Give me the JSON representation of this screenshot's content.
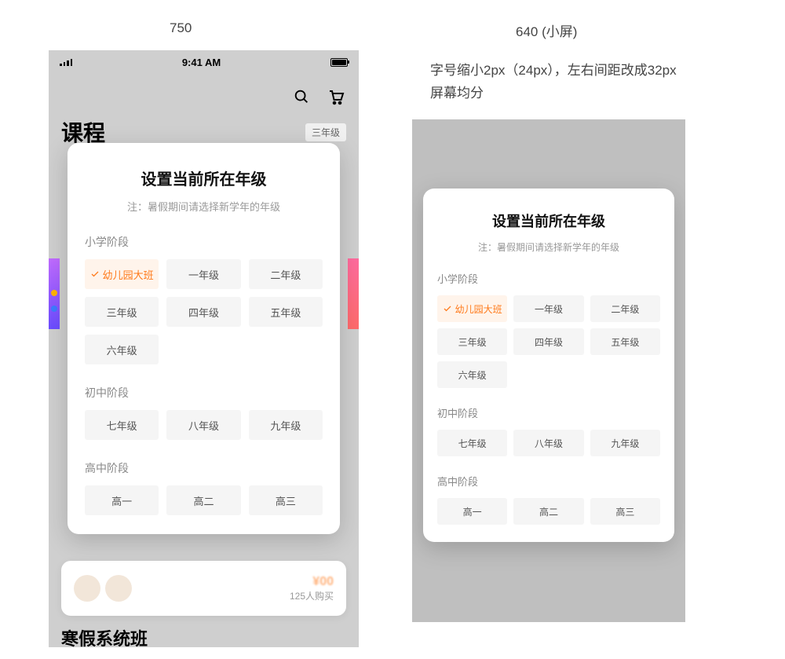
{
  "labels": {
    "col_left": "750",
    "col_right": "640 (小屏)",
    "note_line1": "字号缩小2px（24px），左右间距改成32px",
    "note_line2": "屏幕均分"
  },
  "status": {
    "time": "9:41 AM"
  },
  "header": {
    "page_title": "课程",
    "grade_badge": "三年级"
  },
  "under_card": {
    "buyers": "125人购买",
    "price_hint": "¥00"
  },
  "under_section": "寒假系统班",
  "modal": {
    "title": "设置当前所在年级",
    "subtitle": "注：暑假期间请选择新学年的年级",
    "stages": [
      {
        "label": "小学阶段",
        "options": [
          "幼儿园大班",
          "一年级",
          "二年级",
          "三年级",
          "四年级",
          "五年级",
          "六年级"
        ],
        "selected_index": 0
      },
      {
        "label": "初中阶段",
        "options": [
          "七年级",
          "八年级",
          "九年级"
        ],
        "selected_index": -1
      },
      {
        "label": "高中阶段",
        "options": [
          "高一",
          "高二",
          "高三"
        ],
        "selected_index": -1
      }
    ]
  },
  "colors": {
    "accent": "#ff7a1a",
    "chip_bg": "#f5f5f5",
    "chip_selected_bg": "#fff4eb"
  }
}
